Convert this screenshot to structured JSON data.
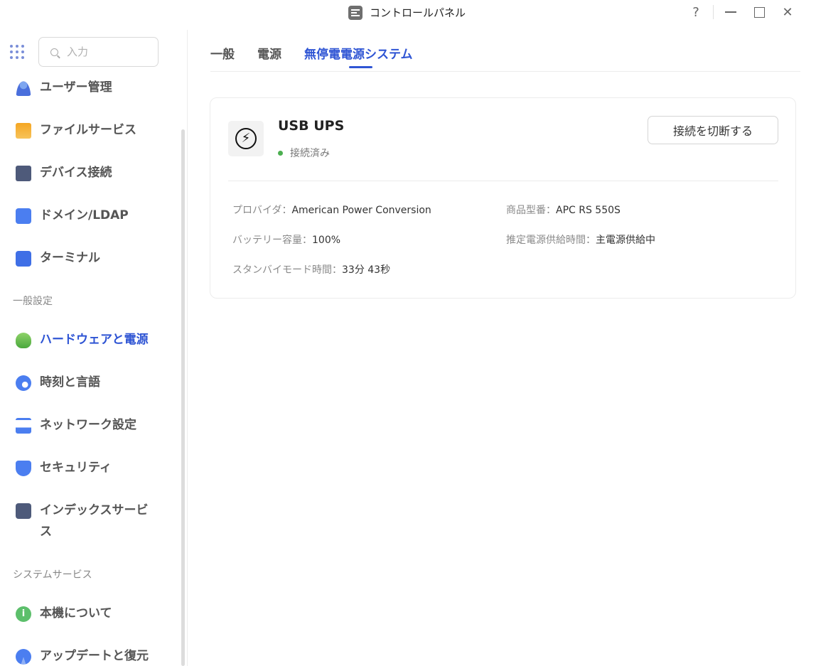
{
  "window": {
    "title": "コントロールパネル",
    "controls": {
      "help": "?"
    }
  },
  "sidebar": {
    "search_placeholder": "入力",
    "items_top": [
      {
        "label": "ユーザー管理",
        "icon": "user-icon"
      },
      {
        "label": "ファイルサービス",
        "icon": "folder-icon"
      },
      {
        "label": "デバイス接続",
        "icon": "device-icon"
      },
      {
        "label": "ドメイン/LDAP",
        "icon": "domain-icon"
      },
      {
        "label": "ターミナル",
        "icon": "terminal-icon"
      }
    ],
    "section_general": "一般設定",
    "items_general": [
      {
        "label": "ハードウェアと電源",
        "icon": "hardware-power-icon",
        "active": true
      },
      {
        "label": "時刻と言語",
        "icon": "time-language-icon"
      },
      {
        "label": "ネットワーク設定",
        "icon": "network-icon"
      },
      {
        "label": "セキュリティ",
        "icon": "shield-icon"
      },
      {
        "label": "インデックスサービス",
        "icon": "index-icon"
      }
    ],
    "section_system": "システムサービス",
    "items_system": [
      {
        "label": "本機について",
        "icon": "info-icon"
      },
      {
        "label": "アップデートと復元",
        "icon": "update-icon"
      }
    ]
  },
  "tabs": [
    {
      "label": "一般"
    },
    {
      "label": "電源"
    },
    {
      "label": "無停電電源システム",
      "active": true
    }
  ],
  "ups": {
    "name": "USB UPS",
    "status": "接続済み",
    "status_color": "#4caf50",
    "disconnect_label": "接続を切断する",
    "details": {
      "provider_label": "プロバイダ：",
      "provider_value": "American Power Conversion",
      "model_label": "商品型番：",
      "model_value": "APC RS 550S",
      "battery_label": "バッテリー容量：",
      "battery_value": "100%",
      "runtime_label": "推定電源供給時間：",
      "runtime_value": "主電源供給中",
      "standby_label": "スタンバイモード時間：",
      "standby_value": "33分 43秒"
    }
  },
  "colors": {
    "accent": "#2f55d4"
  }
}
